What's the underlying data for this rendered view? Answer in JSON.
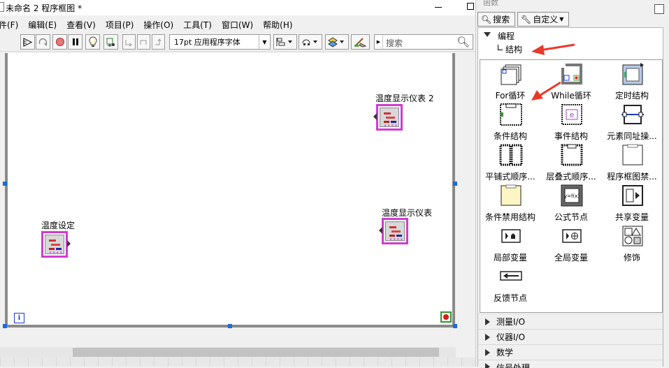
{
  "window": {
    "title": "未命名 2 程序框图 *"
  },
  "menubar": {
    "items": [
      "件(F)",
      "编辑(E)",
      "查看(V)",
      "项目(P)",
      "操作(O)",
      "工具(T)",
      "窗口(W)",
      "帮助(H)"
    ]
  },
  "toolbar": {
    "font_select": "17pt 应用程序字体",
    "search_placeholder": "搜索"
  },
  "diagram": {
    "nodes": [
      {
        "label": "温度显示仪表 2"
      },
      {
        "label": "温度设定"
      },
      {
        "label": "温度显示仪表"
      }
    ],
    "iteration_terminal": "i"
  },
  "palette": {
    "title": "函数",
    "search_button": "搜索",
    "customize_button": "自定义",
    "category_expanded": "编程",
    "subcategory": "结构",
    "items": [
      {
        "label": "For循环",
        "icon": "for-loop-icon"
      },
      {
        "label": "While循环",
        "icon": "while-loop-icon"
      },
      {
        "label": "定时结构",
        "icon": "timed-structure-icon"
      },
      {
        "label": "条件结构",
        "icon": "case-structure-icon"
      },
      {
        "label": "事件结构",
        "icon": "event-structure-icon"
      },
      {
        "label": "元素同址操...",
        "icon": "in-place-element-icon"
      },
      {
        "label": "平铺式顺序...",
        "icon": "flat-sequence-icon"
      },
      {
        "label": "层叠式顺序...",
        "icon": "stacked-sequence-icon"
      },
      {
        "label": "程序框图禁...",
        "icon": "diagram-disable-icon"
      },
      {
        "label": "条件禁用结构",
        "icon": "conditional-disable-icon"
      },
      {
        "label": "公式节点",
        "icon": "formula-node-icon"
      },
      {
        "label": "共享变量",
        "icon": "shared-variable-icon"
      },
      {
        "label": "局部变量",
        "icon": "local-variable-icon"
      },
      {
        "label": "全局变量",
        "icon": "global-variable-icon"
      },
      {
        "label": "修饰",
        "icon": "decorations-icon"
      },
      {
        "label": "反馈节点",
        "icon": "feedback-node-icon"
      }
    ],
    "categories": [
      "测量I/O",
      "仪器I/O",
      "数学",
      "信号处理"
    ]
  },
  "colors": {
    "annotation_arrow": "#e8392b",
    "terminal_border": "#d23ad2",
    "selection_handle": "#1a6be0"
  }
}
